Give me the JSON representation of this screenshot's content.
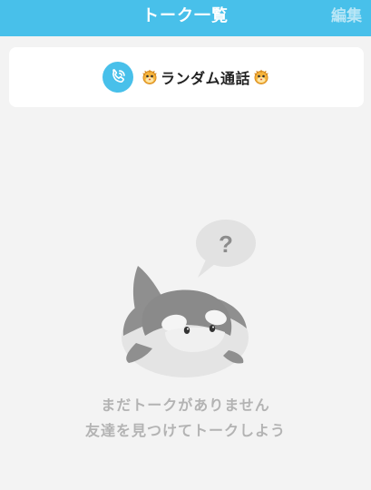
{
  "header": {
    "title": "トーク一覧",
    "edit_label": "編集"
  },
  "random_call": {
    "label": "ランダム通話",
    "icon": "phone-call-icon",
    "decoration_icon": "blowfish-icon"
  },
  "empty_state": {
    "line1": "まだトークがありません",
    "line2": "友達を見つけてトークしよう",
    "bubble_symbol": "?"
  },
  "colors": {
    "accent": "#48c0ea",
    "background": "#f3f3f3",
    "muted_text": "#b3b3b3"
  }
}
